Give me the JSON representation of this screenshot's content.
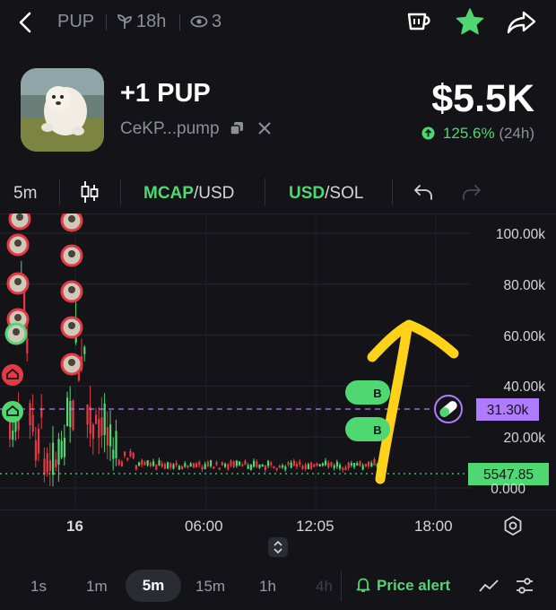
{
  "topbar": {
    "back_icon": "chevron-left-icon",
    "ticker": "PUP",
    "age": "18h",
    "watchers": "3",
    "colors": {
      "accent_green": "#4fd872"
    }
  },
  "token": {
    "name": "+1 PUP",
    "contract": "CeKP...pump",
    "market_cap": "$5.5K",
    "change_pct": "125.6%",
    "change_period": "(24h)"
  },
  "toolbar": {
    "interval": "5m",
    "mcap_label": "MCAP",
    "mcap_unit": "/USD",
    "usd_label": "USD",
    "sol_label": "/SOL"
  },
  "chart": {
    "y_ticks": [
      "100.00k",
      "80.00k",
      "60.00k",
      "40.00k",
      "20.00k",
      "0.000"
    ],
    "x_ticks": [
      "16",
      "06:00",
      "12:05",
      "18:00"
    ],
    "price_tag": "31.30k",
    "last_price": "5547.85",
    "buy_marker": "B"
  },
  "chart_data": {
    "type": "candlestick",
    "series": [
      {
        "name": "MCAP/USD"
      }
    ],
    "ylim": [
      0,
      110000
    ],
    "y_ticks": [
      0,
      20000,
      40000,
      60000,
      80000,
      100000
    ],
    "x_ticks": [
      "16",
      "06:00",
      "12:05",
      "18:00"
    ],
    "reference_lines": [
      31300,
      5547.85
    ],
    "grid": true
  },
  "bottom": {
    "timeframes": [
      "1s",
      "1m",
      "5m",
      "15m",
      "1h",
      "4h"
    ],
    "selected": "5m",
    "price_alert": "Price alert"
  }
}
